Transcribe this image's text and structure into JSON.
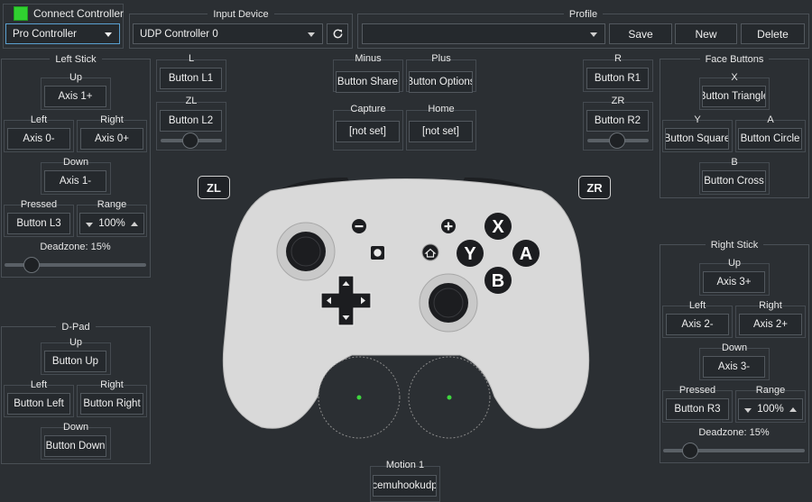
{
  "connect": {
    "label": "Connect Controller",
    "checked": true,
    "accent": "#30d030"
  },
  "controller_type": {
    "value": "Pro Controller"
  },
  "input_device": {
    "title": "Input Device",
    "value": "UDP Controller 0"
  },
  "profile": {
    "title": "Profile",
    "value": "",
    "save": "Save",
    "new": "New",
    "delete": "Delete"
  },
  "left_stick": {
    "title": "Left Stick",
    "up_label": "Up",
    "up": "Axis 1+",
    "left_label": "Left",
    "left": "Axis 0-",
    "right_label": "Right",
    "right": "Axis 0+",
    "down_label": "Down",
    "down": "Axis 1-",
    "pressed_label": "Pressed",
    "pressed": "Button L3",
    "range_label": "Range",
    "range": "100%",
    "deadzone": "Deadzone: 15%",
    "deadzone_value": 0.15
  },
  "dpad": {
    "title": "D-Pad",
    "up_label": "Up",
    "up": "Button Up",
    "left_label": "Left",
    "left": "Button Left",
    "right_label": "Right",
    "right": "Button Right",
    "down_label": "Down",
    "down": "Button Down"
  },
  "l": {
    "label": "L",
    "value": "Button L1"
  },
  "zl": {
    "label": "ZL",
    "value": "Button L2",
    "slider": 0.2
  },
  "minus": {
    "label": "Minus",
    "value": "Button Share"
  },
  "plus": {
    "label": "Plus",
    "value": "Button Options"
  },
  "capture": {
    "label": "Capture",
    "value": "[not set]"
  },
  "home": {
    "label": "Home",
    "value": "[not set]"
  },
  "r": {
    "label": "R",
    "value": "Button R1"
  },
  "zr": {
    "label": "ZR",
    "value": "Button R2",
    "slider": 0.2
  },
  "face": {
    "title": "Face Buttons",
    "x_label": "X",
    "x": "Button Triangle",
    "y_label": "Y",
    "y": "Button Square",
    "a_label": "A",
    "a": "Button Circle",
    "b_label": "B",
    "b": "Button Cross"
  },
  "right_stick": {
    "title": "Right Stick",
    "up_label": "Up",
    "up": "Axis 3+",
    "left_label": "Left",
    "left": "Axis 2-",
    "right_label": "Right",
    "right": "Axis 2+",
    "down_label": "Down",
    "down": "Axis 3-",
    "pressed_label": "Pressed",
    "pressed": "Button R3",
    "range_label": "Range",
    "range": "100%",
    "deadzone": "Deadzone: 15%",
    "deadzone_value": 0.15
  },
  "motion": {
    "label": "Motion 1",
    "value": "cemuhookudp"
  },
  "controller_art": {
    "zl_badge": "ZL",
    "zr_badge": "ZR",
    "x": "X",
    "y": "Y",
    "a": "A",
    "b": "B",
    "body_color": "#d9d9d9",
    "dot_color": "#3ed63e"
  }
}
